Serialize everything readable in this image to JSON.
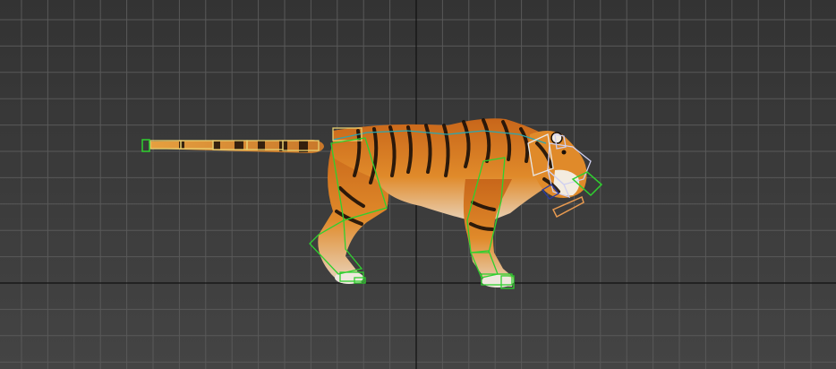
{
  "viewport": {
    "background_top": "#333333",
    "background_bottom": "#444444",
    "grid_color": "#595959",
    "axis_color": "#111111"
  },
  "model": {
    "kind": "tiger-rig",
    "fur_color": "#d97a1c",
    "stripe_color": "#1a0f08",
    "belly_color": "#f0e6d8",
    "bone_color": "#2fd02f",
    "tail_bone_color": "#e8d070",
    "head_bone_color": "#d0d0f0",
    "jaw_bone_color": "#e89a50"
  }
}
